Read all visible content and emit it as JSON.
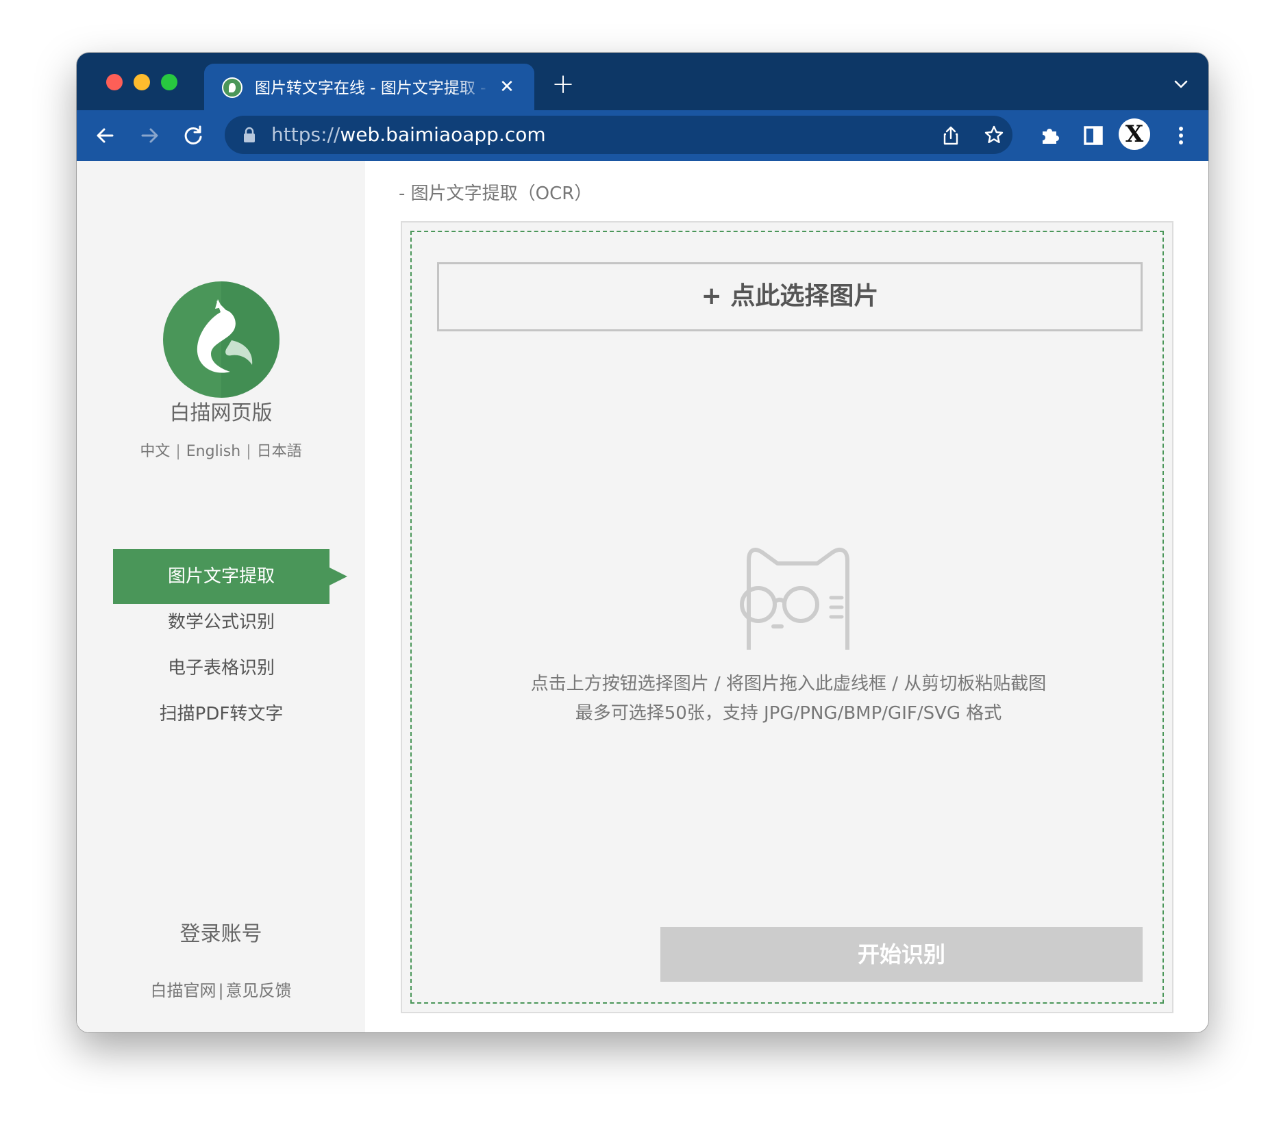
{
  "browser": {
    "tab_title": "图片转文字在线 - 图片文字提取 - 白描网页版",
    "tab_close": "✕",
    "new_tab": "+",
    "url_protocol": "https://",
    "url_host": "web.baimiaoapp.com",
    "profile_initial": "X",
    "icons": [
      "back-icon",
      "forward-icon",
      "reload-icon",
      "lock-icon",
      "share-icon",
      "star-icon",
      "extensions-icon",
      "sidepanel-icon",
      "menu-icon",
      "chevron-down-icon"
    ]
  },
  "sidebar": {
    "brand": "白描网页版",
    "languages": [
      {
        "label": "中文"
      },
      {
        "label": "English"
      },
      {
        "label": "日本語"
      }
    ],
    "lang_separator": "|",
    "nav": [
      {
        "label": "图片文字提取",
        "active": true
      },
      {
        "label": "数学公式识别",
        "active": false
      },
      {
        "label": "电子表格识别",
        "active": false
      },
      {
        "label": "扫描PDF转文字",
        "active": false
      }
    ],
    "login": "登录账号",
    "footer": {
      "official_site": "白描官网",
      "separator": "|",
      "feedback": "意见反馈"
    }
  },
  "main": {
    "title": "- 图片文字提取（OCR）",
    "select_button": "+ 点此选择图片",
    "hint_line1": "点击上方按钮选择图片 / 将图片拖入此虚线框 / 从剪切板粘贴截图",
    "hint_line2": "最多可选择50张，支持 JPG/PNG/BMP/GIF/SVG 格式",
    "start_button": "开始识别"
  },
  "colors": {
    "accent_green": "#4a9659",
    "tabstrip": "#0d3766",
    "toolbar": "#1a56a2",
    "disabled_button": "#cccccc"
  }
}
